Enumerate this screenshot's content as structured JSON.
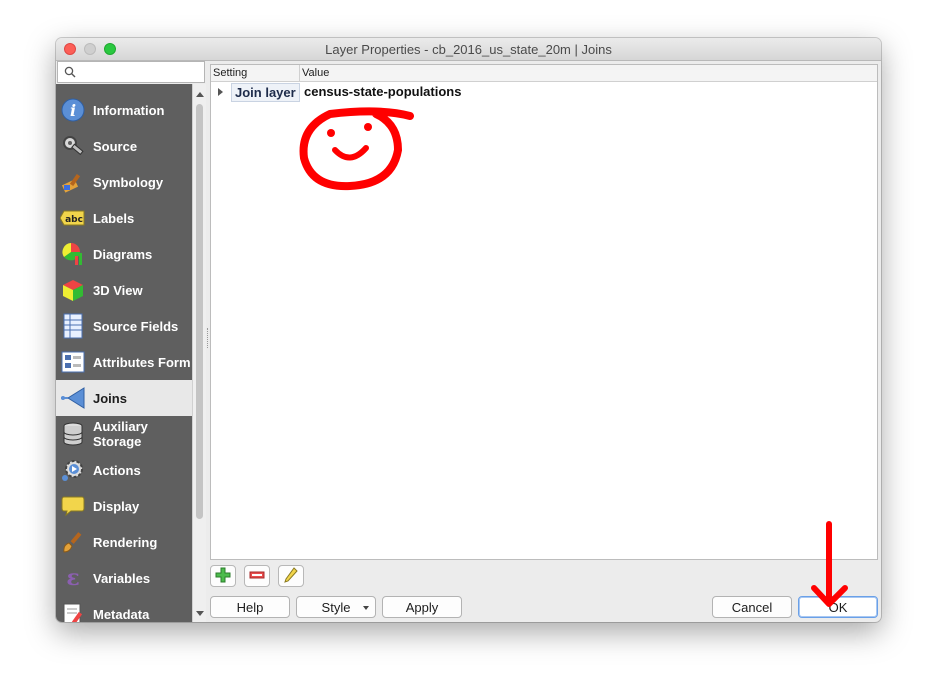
{
  "window": {
    "title": "Layer Properties - cb_2016_us_state_20m | Joins"
  },
  "search": {
    "placeholder": ""
  },
  "sidebar": {
    "items": [
      {
        "label": "Information",
        "icon": "info-icon",
        "active": false
      },
      {
        "label": "Source",
        "icon": "source-wrench-icon",
        "active": false
      },
      {
        "label": "Symbology",
        "icon": "symbology-brush-icon",
        "active": false
      },
      {
        "label": "Labels",
        "icon": "labels-abc-icon",
        "active": false
      },
      {
        "label": "Diagrams",
        "icon": "diagrams-icon",
        "active": false
      },
      {
        "label": "3D View",
        "icon": "3d-cube-icon",
        "active": false
      },
      {
        "label": "Source Fields",
        "icon": "source-fields-icon",
        "active": false
      },
      {
        "label": "Attributes Form",
        "icon": "attributes-form-icon",
        "active": false
      },
      {
        "label": "Joins",
        "icon": "joins-icon",
        "active": true
      },
      {
        "label": "Auxiliary Storage",
        "icon": "auxiliary-storage-icon",
        "active": false
      },
      {
        "label": "Actions",
        "icon": "actions-gear-icon",
        "active": false
      },
      {
        "label": "Display",
        "icon": "display-speech-icon",
        "active": false
      },
      {
        "label": "Rendering",
        "icon": "rendering-brush-icon",
        "active": false
      },
      {
        "label": "Variables",
        "icon": "variables-epsilon-icon",
        "active": false
      },
      {
        "label": "Metadata",
        "icon": "metadata-icon",
        "active": false
      }
    ]
  },
  "tree": {
    "headers": {
      "setting": "Setting",
      "value": "Value"
    },
    "rows": [
      {
        "key": "Join layer",
        "value": "census-state-populations"
      }
    ]
  },
  "tools": {
    "add": "add-join-icon",
    "remove": "remove-join-icon",
    "edit": "edit-join-icon"
  },
  "buttons": {
    "help": "Help",
    "style": "Style",
    "apply": "Apply",
    "cancel": "Cancel",
    "ok": "OK"
  },
  "annotations": {
    "color": "#ff0000"
  },
  "colors": {
    "sidebar_bg": "#5f5f5f",
    "accent": "#6aa0e8"
  }
}
